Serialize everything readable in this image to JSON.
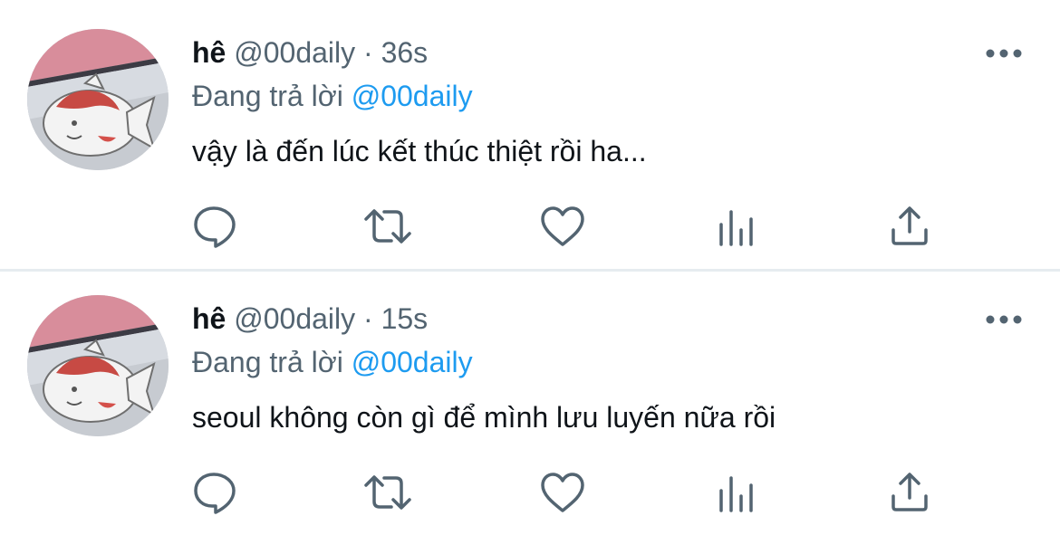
{
  "tweets": [
    {
      "name": "hê",
      "handle": "@00daily",
      "separator": "·",
      "time": "36s",
      "reply_prefix": "Đang trả lời",
      "reply_to": "@00daily",
      "text": "vậy là đến lúc kết thúc thiệt rồi ha...",
      "actions": [
        "reply-icon",
        "retweet-icon",
        "like-icon",
        "analytics-icon",
        "share-icon"
      ]
    },
    {
      "name": "hê",
      "handle": "@00daily",
      "separator": "·",
      "time": "15s",
      "reply_prefix": "Đang trả lời",
      "reply_to": "@00daily",
      "text": "seoul không còn gì để mình lưu luyến nữa rồi",
      "actions": [
        "reply-icon",
        "retweet-icon",
        "like-icon",
        "analytics-icon",
        "share-icon"
      ]
    }
  ],
  "colors": {
    "text": "#0f1419",
    "secondary": "#536471",
    "link": "#1d9bf0",
    "divider": "#e6ecf0"
  }
}
